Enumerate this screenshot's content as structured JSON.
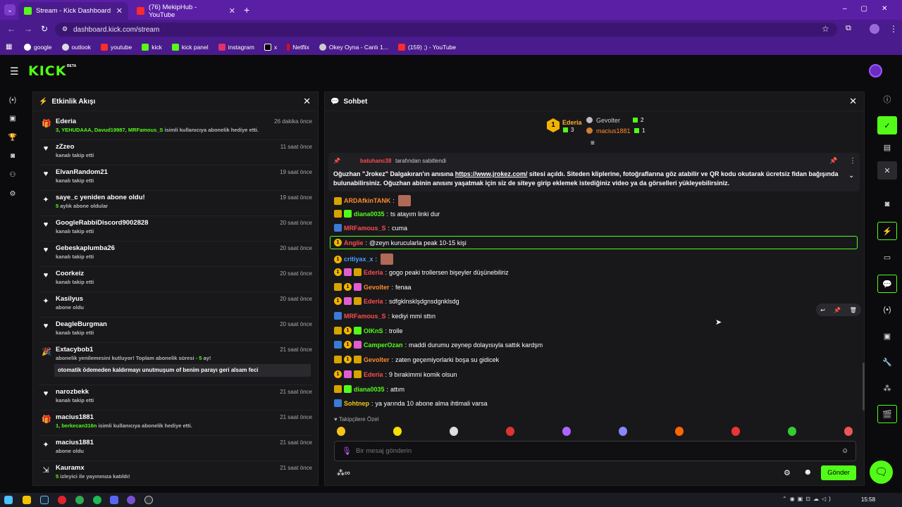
{
  "browser": {
    "tabs": [
      {
        "title": "Stream - Kick Dashboard"
      },
      {
        "title": "(76) MekipHub - YouTube"
      }
    ],
    "new_tab": "+",
    "url": "dashboard.kick.com/stream",
    "bookmarks": [
      "google",
      "outlook",
      "youtube",
      "kick",
      "kick panel",
      "instagram",
      "x",
      "Netflix",
      "Okey Oyna - Canlı 1...",
      "(159) ;) - YouTube"
    ]
  },
  "header": {
    "logo": "KICK",
    "beta": "BETA"
  },
  "activity": {
    "title": "Etkinlik Akışı",
    "items": [
      {
        "icon": "gift-icon",
        "name": "Ederia",
        "time": "26 dakika önce",
        "sub_green": "3, YEHUDAAA, Davud19987, MRFamous_S",
        "sub": " isimli kullanıcıya abonelik hediye etti."
      },
      {
        "icon": "heart-icon",
        "name": "zZzeo",
        "time": "11 saat önce",
        "sub": "kanalı takip etti"
      },
      {
        "icon": "heart-icon",
        "name": "ElvanRandom21",
        "time": "19 saat önce",
        "sub": "kanalı takip etti"
      },
      {
        "icon": "star-icon",
        "name": "saye_c yeniden abone oldu!",
        "time": "19 saat önce",
        "sub_green": "5",
        "sub": " aylık abone oldular"
      },
      {
        "icon": "heart-icon",
        "name": "GoogleRabbiDiscord9002828",
        "time": "20 saat önce",
        "sub": "kanalı takip etti"
      },
      {
        "icon": "heart-icon",
        "name": "Gebeskaplumba26",
        "time": "20 saat önce",
        "sub": "kanalı takip etti"
      },
      {
        "icon": "heart-icon",
        "name": "Coorkeiz",
        "time": "20 saat önce",
        "sub": "kanalı takip etti"
      },
      {
        "icon": "star-icon",
        "name": "Kasilyus",
        "time": "20 saat önce",
        "sub": "abone oldu"
      },
      {
        "icon": "heart-icon",
        "name": "DeagleBurgman",
        "time": "20 saat önce",
        "sub": "kanalı takip etti"
      },
      {
        "icon": "party-icon",
        "name": "Extacybob1",
        "time": "21 saat önce",
        "sub": "abonelik yenilemesini kutluyor! Toplam abonelik süresi - ",
        "sub_green2": "5",
        "sub_end": " ay!",
        "quote": "otomatik ödemeden kaldırmayı unutmuşum of benim parayı geri alsam feci"
      },
      {
        "icon": "heart-icon",
        "name": "narozbekk",
        "time": "21 saat önce",
        "sub": "kanalı takip etti"
      },
      {
        "icon": "gift-icon",
        "name": "macius1881",
        "time": "21 saat önce",
        "sub_green": "1, berkecan316n",
        "sub": " isimli kullanıcıya abonelik hediye etti."
      },
      {
        "icon": "star-icon",
        "name": "macius1881",
        "time": "21 saat önce",
        "sub": "abone oldu"
      },
      {
        "icon": "raid-icon",
        "name": "Kauramx",
        "time": "21 saat önce",
        "sub_green": "5",
        "sub": " izleyici ile yayınınıza katıldı!"
      }
    ]
  },
  "chat": {
    "title": "Sohbet",
    "leaderboard": {
      "first": {
        "rank": "1",
        "name": "Ederia",
        "count": "3"
      },
      "second": {
        "name": "Gevolter",
        "count": "2"
      },
      "third": {
        "name": "macius1881",
        "count": "1"
      }
    },
    "pinned": {
      "by_user": "batuhanc38",
      "by_label": "tarafından sabitlendi",
      "text_a": "Oğuzhan \"Jrokez\" Dalgakıran'ın anısına ",
      "link": "https://www.jrokez.com/",
      "text_b": " sitesi açıldı. Siteden kliplerine, fotoğraflarına göz atabilir ve QR kodu okutarak ücretsiz fidan bağışında bulunabilirsiniz. Oğuzhan abinin anısını yaşatmak için siz de siteye girip eklemek istediğiniz video ya da görselleri yükleyebilirsiniz."
    },
    "messages": [
      {
        "user": "ARDAfkinTANK",
        "color": "u-orange",
        "text": "",
        "emote": true
      },
      {
        "user": "diana0035",
        "color": "u-green",
        "text": "ts atayım linki dur"
      },
      {
        "user": "MRFamous_S",
        "color": "u-red",
        "text": "cuma"
      },
      {
        "user": "Angiie",
        "color": "u-red",
        "text": "@zeyn kurucularla peak 10-15 kişi",
        "highlight": true
      },
      {
        "user": "critiyax_x",
        "color": "u-blue",
        "text": "",
        "emote": true
      },
      {
        "user": "Ederia",
        "color": "u-red",
        "text": "gogo peaki trollersen bişeyler düşünebiliriz"
      },
      {
        "user": "Gevolter",
        "color": "u-orange",
        "text": "fenaa"
      },
      {
        "user": "Ederia",
        "color": "u-red",
        "text": "sdfgklnsklşdgnsdgnklsdg"
      },
      {
        "user": "MRFamous_S",
        "color": "u-red",
        "text": "kediyi mmi sttın"
      },
      {
        "user": "OlKnS",
        "color": "u-green",
        "text": "trolle"
      },
      {
        "user": "CamperOzan",
        "color": "u-green",
        "text": "maddi durumu zeynep dolayısıyla sattık kardşm"
      },
      {
        "user": "Gevolter",
        "color": "u-orange",
        "text": "zaten geçemiyorlarki boşa su gidicek"
      },
      {
        "user": "Ederia",
        "color": "u-red",
        "text": "9 bırakimmi komik olsun"
      },
      {
        "user": "diana0035",
        "color": "u-green",
        "text": "attım"
      },
      {
        "user": "Sohtnep",
        "color": "u-yellow",
        "text": "ya yarında 10 abone alma ihtimali varsa"
      }
    ],
    "emote_section": "Takipçilere Özel",
    "input_placeholder": "Bir mesaj gönderin",
    "send_label": "Gönder"
  },
  "taskbar": {
    "time": "15:58"
  }
}
